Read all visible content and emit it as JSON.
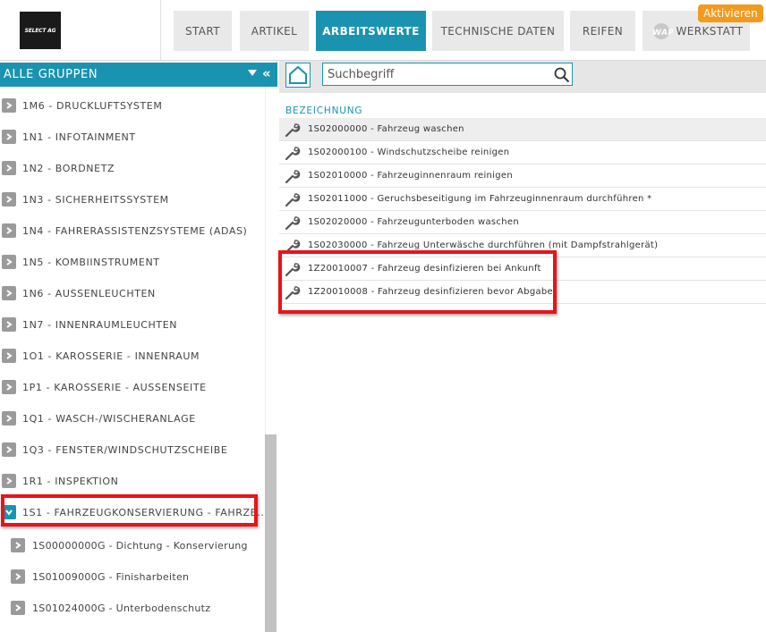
{
  "brand": {
    "logo_text": "SELECT AG"
  },
  "nav": {
    "tabs": [
      {
        "label": "START"
      },
      {
        "label": "ARTIKEL"
      },
      {
        "label": "ARBEITSWERTE"
      },
      {
        "label": "TECHNISCHE DATEN"
      },
      {
        "label": "REIFEN"
      },
      {
        "label": "WERKSTATT"
      }
    ],
    "active_tab": "ARBEITSWERTE",
    "badge": "Aktivieren",
    "wap_icon": "wap-logo-icon"
  },
  "sidebar": {
    "header_title": "ALLE GRUPPEN",
    "collapse_symbol": "«",
    "items": [
      {
        "label": "1M6 - DRUCKLUFTSYSTEM"
      },
      {
        "label": "1N1 - INFOTAINMENT"
      },
      {
        "label": "1N2 - BORDNETZ"
      },
      {
        "label": "1N3 - SICHERHEITSSYSTEM"
      },
      {
        "label": "1N4 - FAHRERASSISTENZSYSTEME (ADAS)"
      },
      {
        "label": "1N5 - KOMBIINSTRUMENT"
      },
      {
        "label": "1N6 - AUSSENLEUCHTEN"
      },
      {
        "label": "1N7 - INNENRAUMLEUCHTEN"
      },
      {
        "label": "1O1 - KAROSSERIE - INNENRAUM"
      },
      {
        "label": "1P1 - KAROSSERIE - AUSSENSEITE"
      },
      {
        "label": "1Q1 - WASCH-/WISCHERANLAGE"
      },
      {
        "label": "1Q3 - FENSTER/WINDSCHUTZSCHEIBE"
      },
      {
        "label": "1R1 - INSPEKTION"
      },
      {
        "label": "1S1 - FAHRZEUGKONSERVIERUNG - FAHRZE..."
      },
      {
        "label": "1S00000000G - Dichtung - Konservierung"
      },
      {
        "label": "1S01009000G - Finisharbeiten"
      },
      {
        "label": "1S01024000G - Unterbodenschutz"
      }
    ],
    "expanded_item": "1S1 - FAHRZEUGKONSERVIERUNG - FAHRZE..."
  },
  "search": {
    "placeholder": "Suchbegriff"
  },
  "results": {
    "column_header": "BEZEICHNUNG",
    "rows": [
      {
        "text": "1S02000000 - Fahrzeug waschen"
      },
      {
        "text": "1S02000100 - Windschutzscheibe reinigen"
      },
      {
        "text": "1S02010000 - Fahrzeuginnenraum reinigen"
      },
      {
        "text": "1S02011000 - Geruchsbeseitigung im Fahrzeuginnenraum durchführen *"
      },
      {
        "text": "1S02020000 - Fahrzeugunterboden waschen"
      },
      {
        "text": "1S02030000 - Fahrzeug Unterwäsche durchführen (mit Dampfstrahlgerät)"
      },
      {
        "text": "1Z20010007 - Fahrzeug desinfizieren bei Ankunft"
      },
      {
        "text": "1Z20010008 - Fahrzeug desinfizieren bevor Abgabe"
      }
    ]
  },
  "colors": {
    "accent": "#1a93b0",
    "badge": "#f39a1e",
    "highlight": "#e8141b"
  }
}
